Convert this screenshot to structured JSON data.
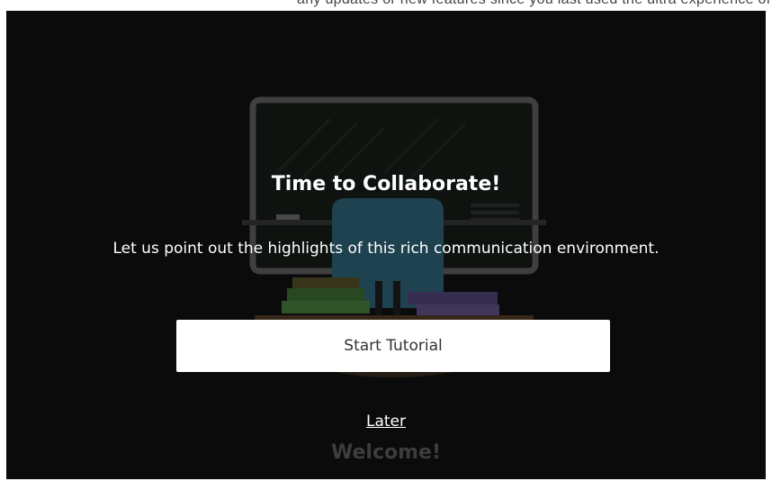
{
  "header": {
    "partial_text": "any updates or new features since you last used the ultra experience of Collaborate"
  },
  "dialog": {
    "title": "Time to Collaborate!",
    "subtitle": "Let us point out the highlights of this rich communication environment.",
    "start_button_label": "Start Tutorial",
    "later_link_label": "Later",
    "welcome_text": "Welcome!"
  },
  "colors": {
    "overlay_background": "#0b0b0b",
    "primary_text": "#ffffff",
    "button_background": "#ffffff",
    "button_text": "#333333",
    "welcome_text": "#3d3d3d"
  }
}
